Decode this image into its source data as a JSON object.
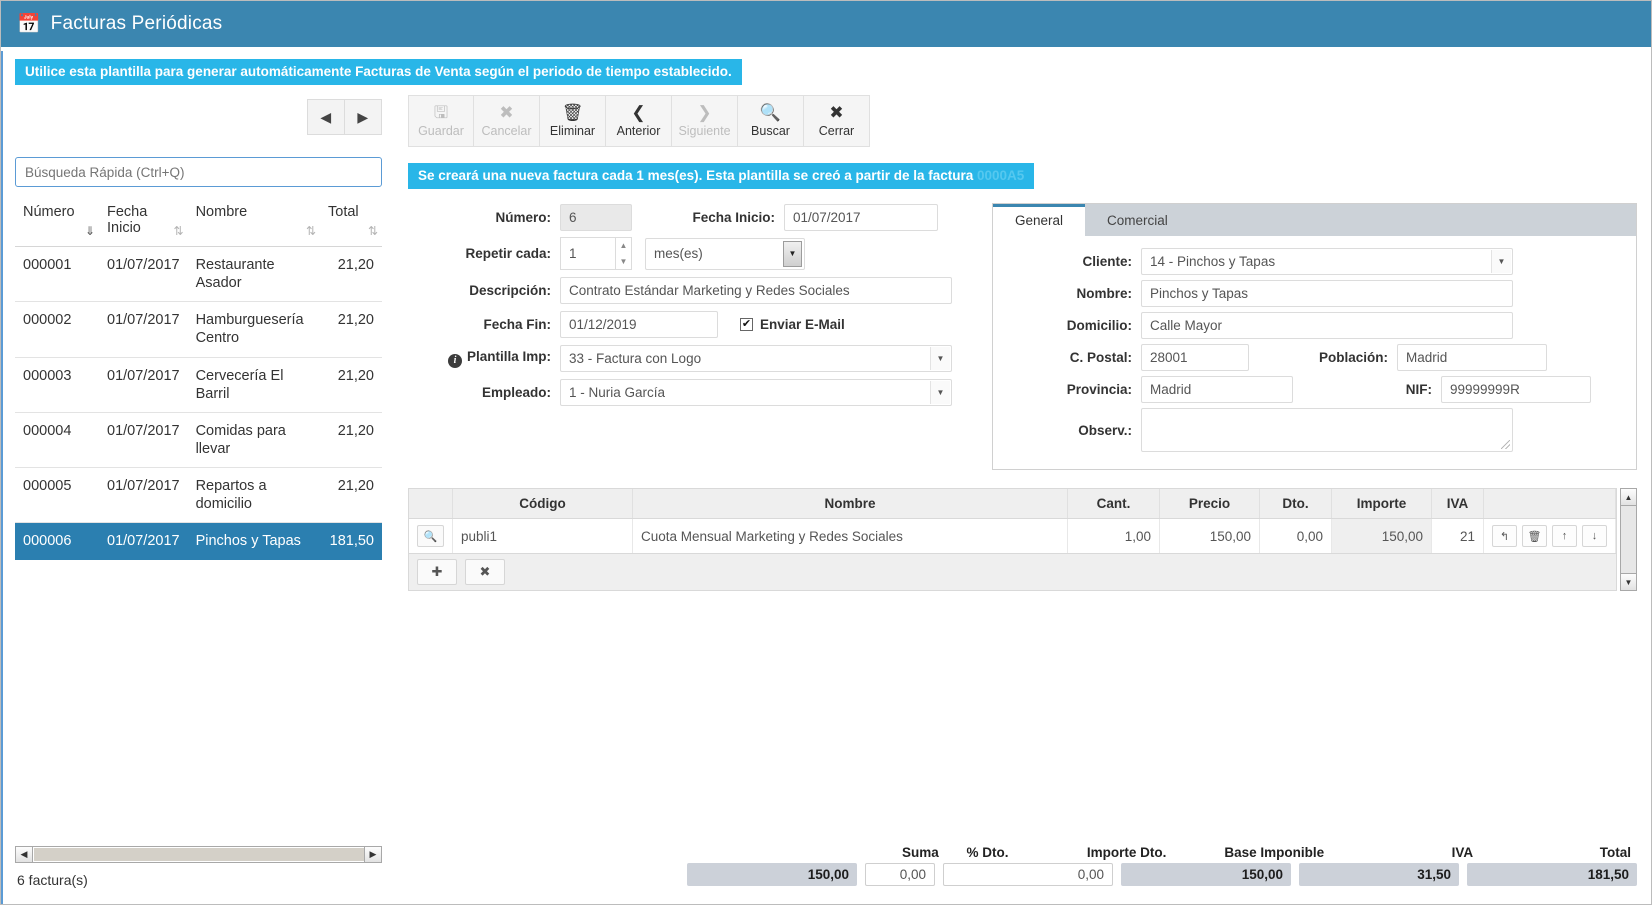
{
  "window": {
    "title": "Facturas Periódicas",
    "icon": "calendar-icon"
  },
  "banner": {
    "text": "Utilice esta plantilla para generar automáticamente Facturas de Venta según el periodo de tiempo establecido."
  },
  "pager": {
    "prev": "◀",
    "next": "▶"
  },
  "search": {
    "placeholder": "Búsqueda Rápida (Ctrl+Q)",
    "value": ""
  },
  "list": {
    "columns": [
      "Número",
      "Fecha Inicio",
      "Nombre",
      "Total"
    ],
    "rows": [
      {
        "numero": "000001",
        "fecha": "01/07/2017",
        "nombre": "Restaurante Asador",
        "total": "21,20",
        "selected": false
      },
      {
        "numero": "000002",
        "fecha": "01/07/2017",
        "nombre": "Hamburguesería Centro",
        "total": "21,20",
        "selected": false
      },
      {
        "numero": "000003",
        "fecha": "01/07/2017",
        "nombre": "Cervecería El Barril",
        "total": "21,20",
        "selected": false
      },
      {
        "numero": "000004",
        "fecha": "01/07/2017",
        "nombre": "Comidas para llevar",
        "total": "21,20",
        "selected": false
      },
      {
        "numero": "000005",
        "fecha": "01/07/2017",
        "nombre": "Repartos a domicilio",
        "total": "21,20",
        "selected": false
      },
      {
        "numero": "000006",
        "fecha": "01/07/2017",
        "nombre": "Pinchos y Tapas",
        "total": "181,50",
        "selected": true
      }
    ],
    "record_count": "6 factura(s)"
  },
  "toolbar": [
    {
      "label": "Guardar",
      "icon": "save-icon",
      "glyph": "🖫",
      "disabled": true
    },
    {
      "label": "Cancelar",
      "icon": "cancel-icon",
      "glyph": "✖",
      "disabled": true
    },
    {
      "label": "Eliminar",
      "icon": "trash-icon",
      "glyph": "🗑",
      "disabled": false
    },
    {
      "label": "Anterior",
      "icon": "chevron-left-icon",
      "glyph": "❮",
      "disabled": false
    },
    {
      "label": "Siguiente",
      "icon": "chevron-right-icon",
      "glyph": "❯",
      "disabled": true
    },
    {
      "label": "Buscar",
      "icon": "search-icon",
      "glyph": "🔍",
      "disabled": false
    },
    {
      "label": "Cerrar",
      "icon": "close-icon",
      "glyph": "✖",
      "disabled": false
    }
  ],
  "info_strip": {
    "text": "Se creará una nueva factura cada 1 mes(es).  Esta plantilla se creó a partir de la factura ",
    "ref": "0000A5"
  },
  "form": {
    "numero_label": "Número:",
    "numero_value": "6",
    "fecha_inicio_label": "Fecha Inicio:",
    "fecha_inicio_value": "01/07/2017",
    "repetir_label": "Repetir cada:",
    "repetir_value": "1",
    "periodo_value": "mes(es)",
    "descripcion_label": "Descripción:",
    "descripcion_value": "Contrato Estándar Marketing y Redes Sociales",
    "fecha_fin_label": "Fecha Fin:",
    "fecha_fin_value": "01/12/2019",
    "enviar_email_label": "Enviar E-Mail",
    "enviar_email_checked": "✔",
    "plantilla_label": "Plantilla Imp:",
    "plantilla_value": "33 - Factura con Logo",
    "empleado_label": "Empleado:",
    "empleado_value": "1 - Nuria García"
  },
  "card": {
    "tabs": [
      {
        "label": "General",
        "active": true
      },
      {
        "label": "Comercial",
        "active": false
      }
    ],
    "cliente_label": "Cliente:",
    "cliente_value": "14 - Pinchos y Tapas",
    "nombre_label": "Nombre:",
    "nombre_value": "Pinchos y Tapas",
    "domicilio_label": "Domicilio:",
    "domicilio_value": "Calle Mayor",
    "cpostal_label": "C. Postal:",
    "cpostal_value": "28001",
    "poblacion_label": "Población:",
    "poblacion_value": "Madrid",
    "provincia_label": "Provincia:",
    "provincia_value": "Madrid",
    "nif_label": "NIF:",
    "nif_value": "99999999R",
    "observ_label": "Observ.:",
    "observ_value": ""
  },
  "items": {
    "columns": [
      "",
      "Código",
      "Nombre",
      "Cant.",
      "Precio",
      "Dto.",
      "Importe",
      "IVA",
      ""
    ],
    "rows": [
      {
        "codigo": "publi1",
        "nombre": "Cuota Mensual Marketing y Redes Sociales",
        "cant": "1,00",
        "precio": "150,00",
        "dto": "0,00",
        "importe": "150,00",
        "iva": "21"
      }
    ],
    "row_actions": [
      {
        "icon": "undo-icon",
        "glyph": "↰"
      },
      {
        "icon": "trash-icon",
        "glyph": "🗑"
      },
      {
        "icon": "arrow-up-icon",
        "glyph": "↑"
      },
      {
        "icon": "arrow-down-icon",
        "glyph": "↓"
      }
    ],
    "add_label": "✚",
    "remove_label": "✖",
    "lookup_icon": "🔍"
  },
  "totals": {
    "suma_label": "Suma",
    "suma_value": "150,00",
    "pdto_label": "% Dto.",
    "pdto_value": "0,00",
    "idto_label": "Importe Dto.",
    "idto_value": "0,00",
    "base_label": "Base Imponible",
    "base_value": "150,00",
    "iva_label": "IVA",
    "iva_value": "31,50",
    "total_label": "Total",
    "total_value": "181,50"
  },
  "colors": {
    "title_bar": "#3b86b0",
    "banner": "#29b6e8",
    "selection": "#2b7fb0",
    "accent": "#5b9bd5"
  }
}
